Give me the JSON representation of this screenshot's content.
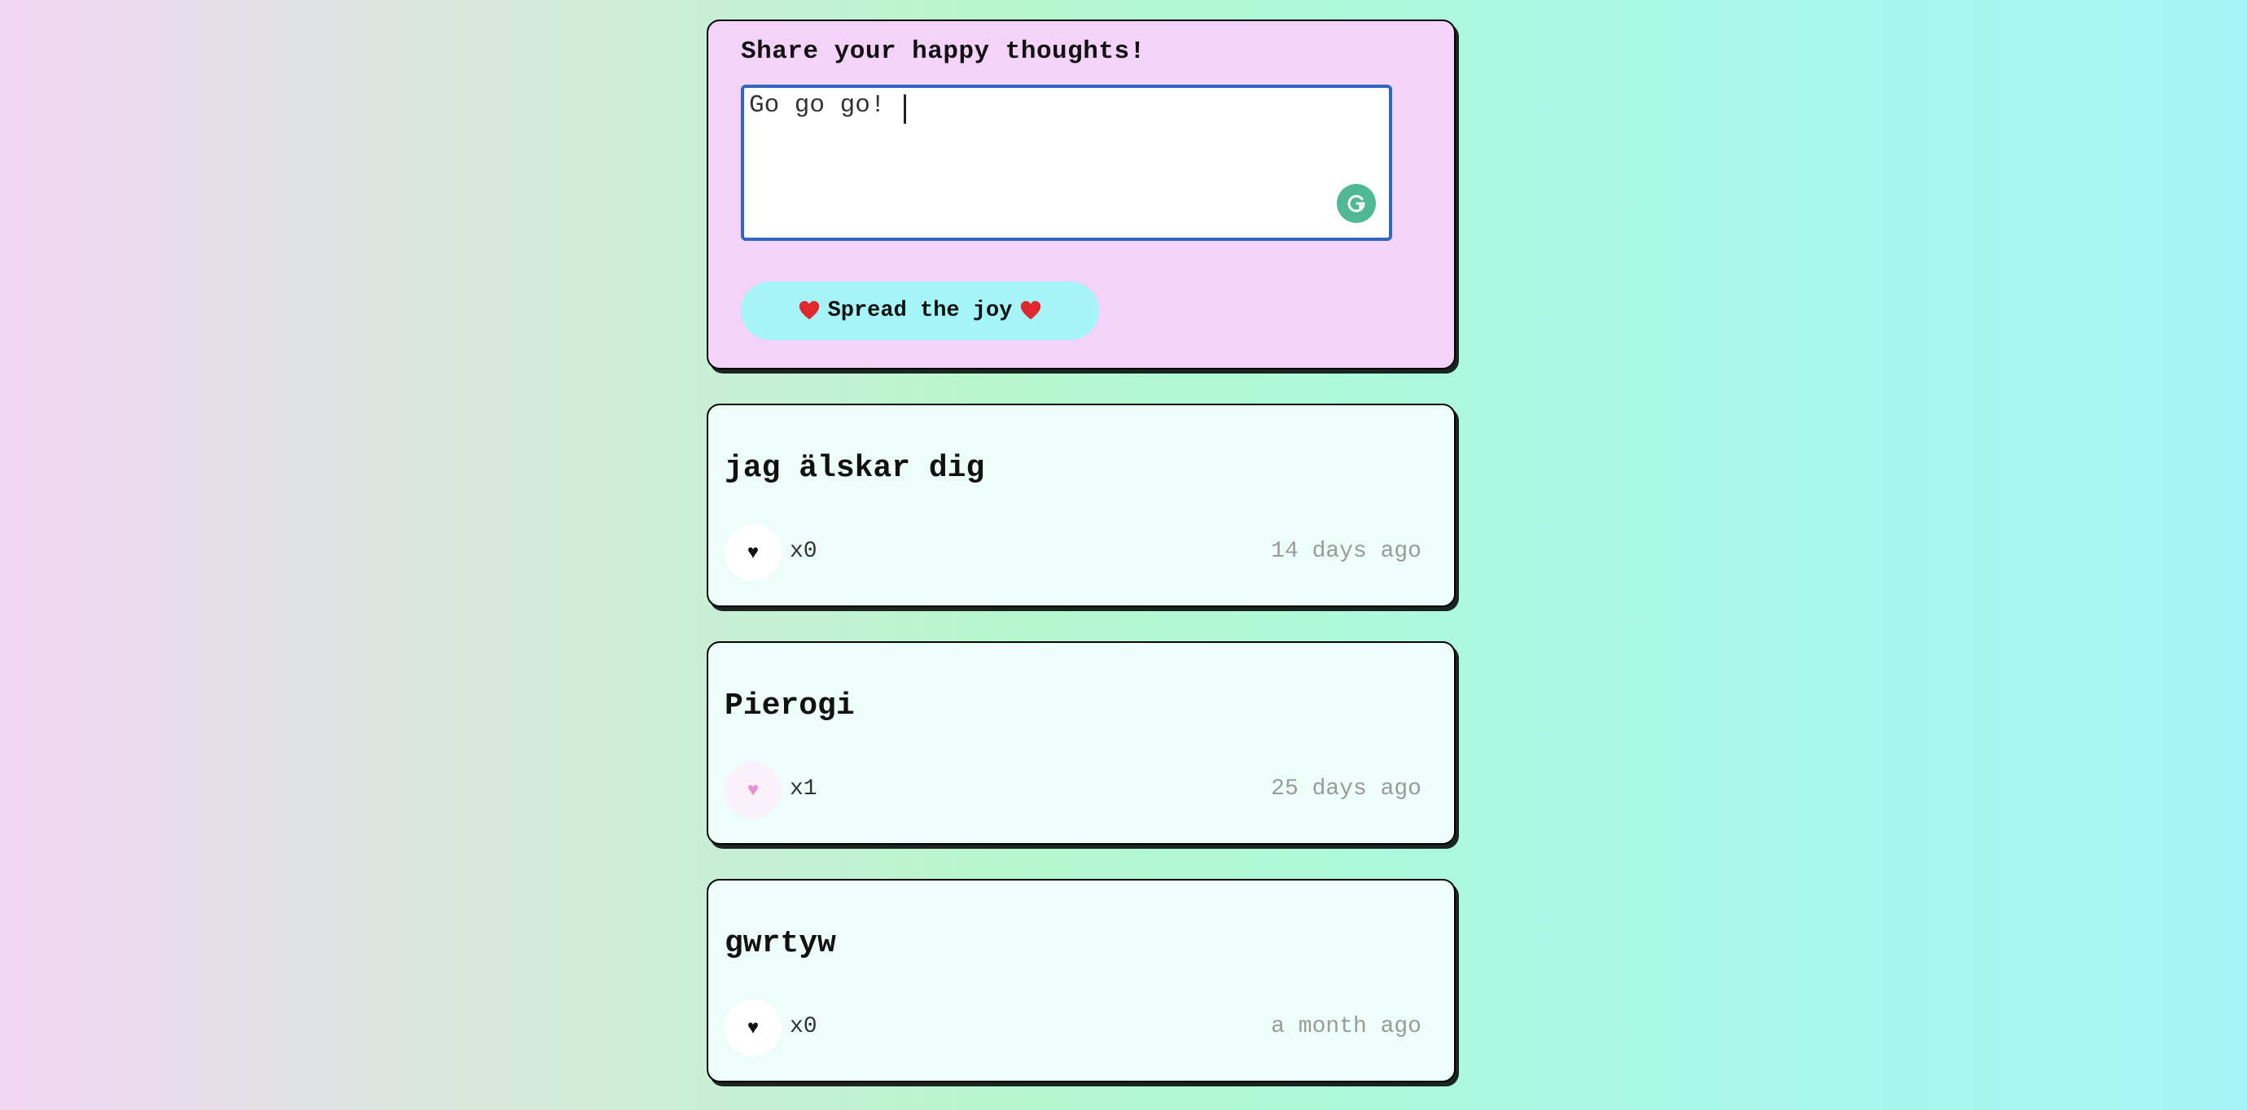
{
  "form": {
    "title": "Share your happy thoughts!",
    "input_value": "Go go go!",
    "submit_label": "Spread the joy",
    "heart_color": "#e0282e"
  },
  "colors": {
    "form_background": "#f5d2f9",
    "button_background": "#a5f5f8",
    "card_background": "#edfdfa",
    "liked_heart": "#e890d8",
    "unliked_heart": "#111111"
  },
  "thoughts": [
    {
      "message": "jag älskar dig",
      "likes": "x0",
      "time": "14 days ago",
      "liked": false
    },
    {
      "message": "Pierogi",
      "likes": "x1",
      "time": "25 days ago",
      "liked": true
    },
    {
      "message": "gwrtyw",
      "likes": "x0",
      "time": "a month ago",
      "liked": false
    }
  ]
}
